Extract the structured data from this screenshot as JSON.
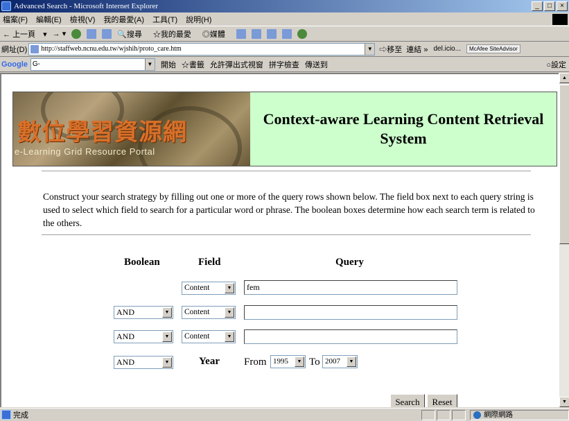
{
  "window": {
    "title": "Advanced Search - Microsoft Internet Explorer",
    "min": "_",
    "max": "□",
    "close": "×"
  },
  "menu": [
    "檔案(F)",
    "編輯(E)",
    "檢視(V)",
    "我的最愛(A)",
    "工具(T)",
    "說明(H)"
  ],
  "toolbar": {
    "back": "上一頁",
    "search": "搜尋",
    "favorites": "我的最愛",
    "media": "媒體"
  },
  "address": {
    "label": "網址(D)",
    "url": "http://staffweb.ncnu.edu.tw/wjshih/proto_care.htm",
    "go": "移至",
    "links": "連結 »",
    "delicious": "del.icio...",
    "mcafee": "McAfee SiteAdvisor"
  },
  "google": {
    "logo": "Google",
    "query": "G-",
    "start": "開始",
    "bookmarks": "書籤",
    "popups": "允許彈出式視窗",
    "spell": "拼字檢查",
    "send": "傳送到",
    "settings": "設定"
  },
  "banner": {
    "chinese": "數位學習資源網",
    "english": "e-Learning Grid Resource Portal",
    "title": "Context-aware Learning Content Retrieval System"
  },
  "intro": "Construct your search strategy by filling out one or more of the query rows shown below. The field box next to each query string is used to select which field to search for a particular word or phrase. The boolean boxes determine how each search term is related to the others.",
  "form": {
    "headers": {
      "boolean": "Boolean",
      "field": "Field",
      "query": "Query"
    },
    "rows": [
      {
        "field": "Content",
        "query": "fem"
      },
      {
        "boolean": "AND",
        "field": "Content",
        "query": ""
      },
      {
        "boolean": "AND",
        "field": "Content",
        "query": ""
      }
    ],
    "year": {
      "boolean": "AND",
      "label": "Year",
      "from_label": "From",
      "from": "1995",
      "to_label": "To",
      "to": "2007"
    },
    "search_button": "Search",
    "reset_button": "Reset"
  },
  "status": {
    "text": "完成",
    "zone": "網際網路"
  }
}
